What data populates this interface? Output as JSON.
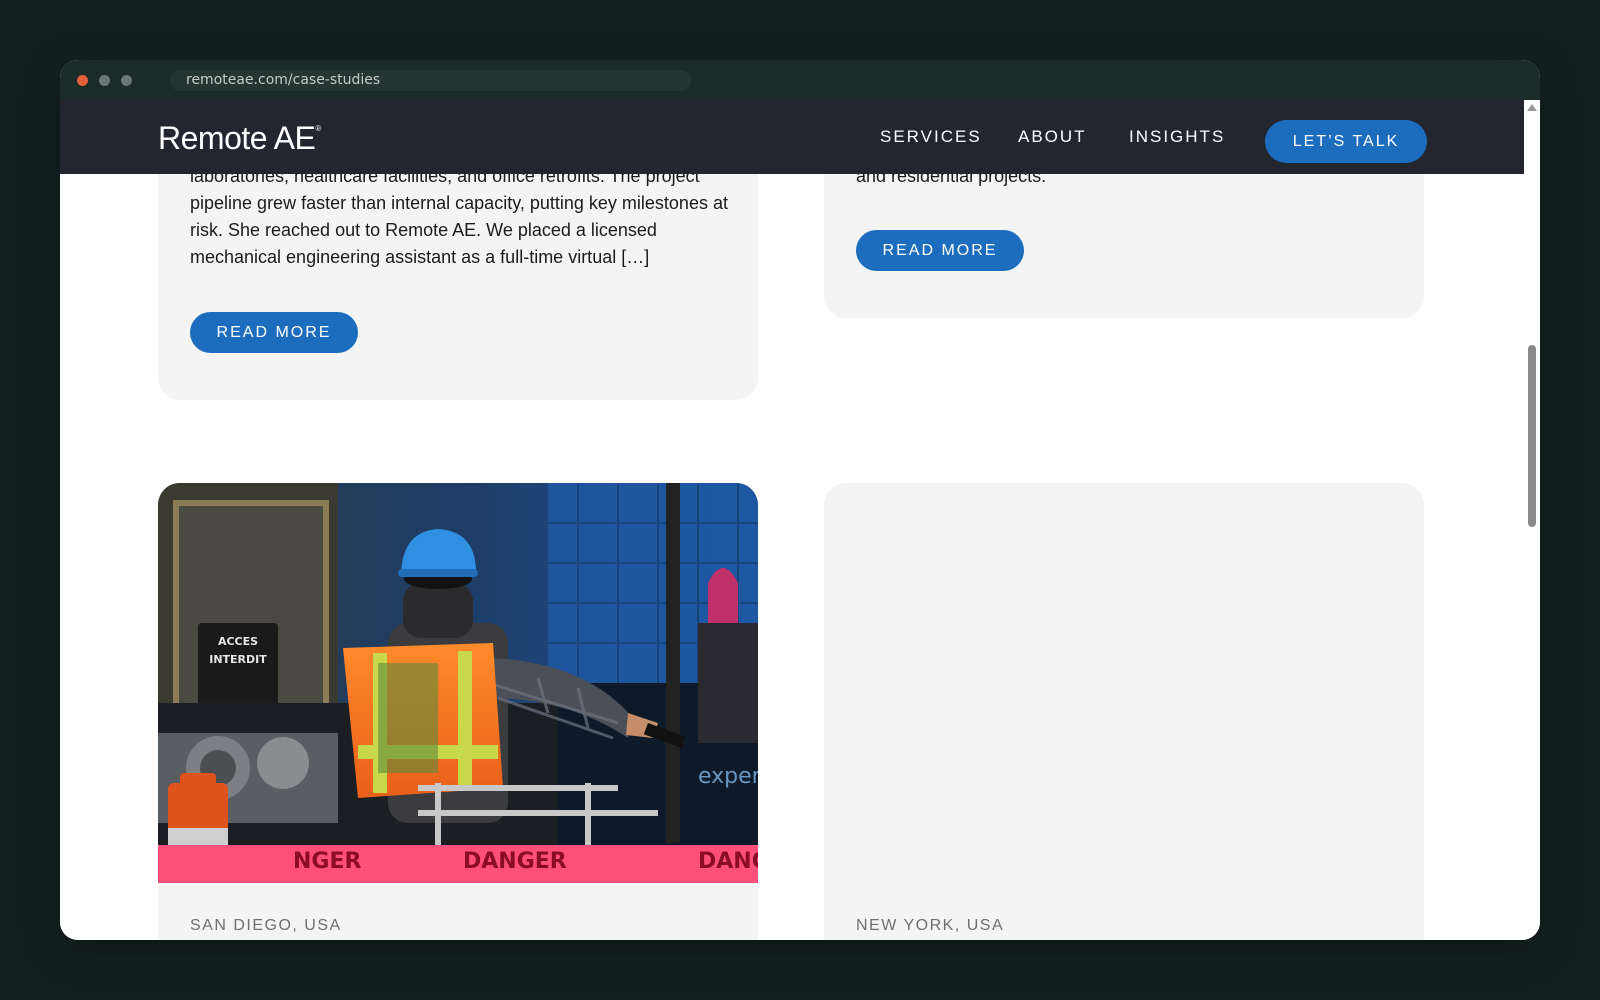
{
  "browser": {
    "url": "remoteae.com/case-studies"
  },
  "nav": {
    "logo_text": "Remote AE",
    "logo_mark": "®",
    "links": [
      {
        "label": "SERVICES",
        "icon": "none"
      },
      {
        "label": "ABOUT",
        "icon": "none"
      },
      {
        "label": "INSIGHTS",
        "icon": "none"
      }
    ],
    "cta_label": "LET’S TALK"
  },
  "cards": [
    {
      "excerpt": "laboratories, healthcare facilities, and office retrofits. The project pipeline grew faster than internal capacity, putting key milestones at risk. She reached out to Remote AE. We placed a licensed mechanical engineering assistant as a full-time virtual […]",
      "button_label": "READ MORE"
    },
    {
      "excerpt": "and residential projects.",
      "button_label": "READ MORE"
    },
    {
      "location": "SAN DIEGO, USA",
      "image": "construction-worker-photo"
    },
    {
      "location": "NEW YORK, USA",
      "image": "empty-placeholder"
    }
  ],
  "photo_text": {
    "tape_word": "DANGER",
    "tape_left": "NGER",
    "tape_right": "DANG",
    "sign_top": "ACCES",
    "sign_bottom": "INTERDIT",
    "window_text": "expert"
  },
  "colors": {
    "accent": "#1c6dbd",
    "nav_bg": "#23262f",
    "card_bg": "#f4f4f4",
    "page_bg": "#132220"
  }
}
